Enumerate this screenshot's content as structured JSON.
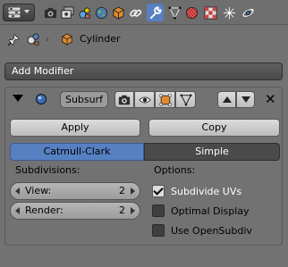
{
  "header": {
    "active_tab": "modifiers",
    "tabs": [
      {
        "name": "render-tab",
        "icon": "camera-icon"
      },
      {
        "name": "render-layers-tab",
        "icon": "render-layers-icon"
      },
      {
        "name": "scene-tab",
        "icon": "scene-icon"
      },
      {
        "name": "world-tab",
        "icon": "world-icon"
      },
      {
        "name": "object-tab",
        "icon": "object-cube-icon"
      },
      {
        "name": "constraints-tab",
        "icon": "constraint-link-icon"
      },
      {
        "name": "modifiers-tab",
        "icon": "wrench-icon"
      },
      {
        "name": "data-tab",
        "icon": "mesh-data-icon"
      },
      {
        "name": "material-tab",
        "icon": "material-sphere-icon"
      },
      {
        "name": "texture-tab",
        "icon": "checker-texture-icon"
      },
      {
        "name": "particles-tab",
        "icon": "particles-icon"
      },
      {
        "name": "physics-tab",
        "icon": "physics-orbit-icon"
      }
    ]
  },
  "context": {
    "object_name": "Cylinder"
  },
  "add_modifier": {
    "label": "Add Modifier"
  },
  "modifier": {
    "name": "Subsurf",
    "apply_label": "Apply",
    "copy_label": "Copy",
    "subdivision_types": [
      "Catmull-Clark",
      "Simple"
    ],
    "selected_type": "Catmull-Clark",
    "subdivisions_label": "Subdivisions:",
    "view_label": "View:",
    "view_value": "2",
    "render_label": "Render:",
    "render_value": "2",
    "options_label": "Options:",
    "options": [
      {
        "label": "Subdivide UVs",
        "checked": true
      },
      {
        "label": "Optimal Display",
        "checked": false
      },
      {
        "label": "Use OpenSubdiv",
        "checked": false
      }
    ]
  },
  "colors": {
    "background": "#727272",
    "accent": "#5680c2",
    "dark_button": "#4a4a4a"
  }
}
